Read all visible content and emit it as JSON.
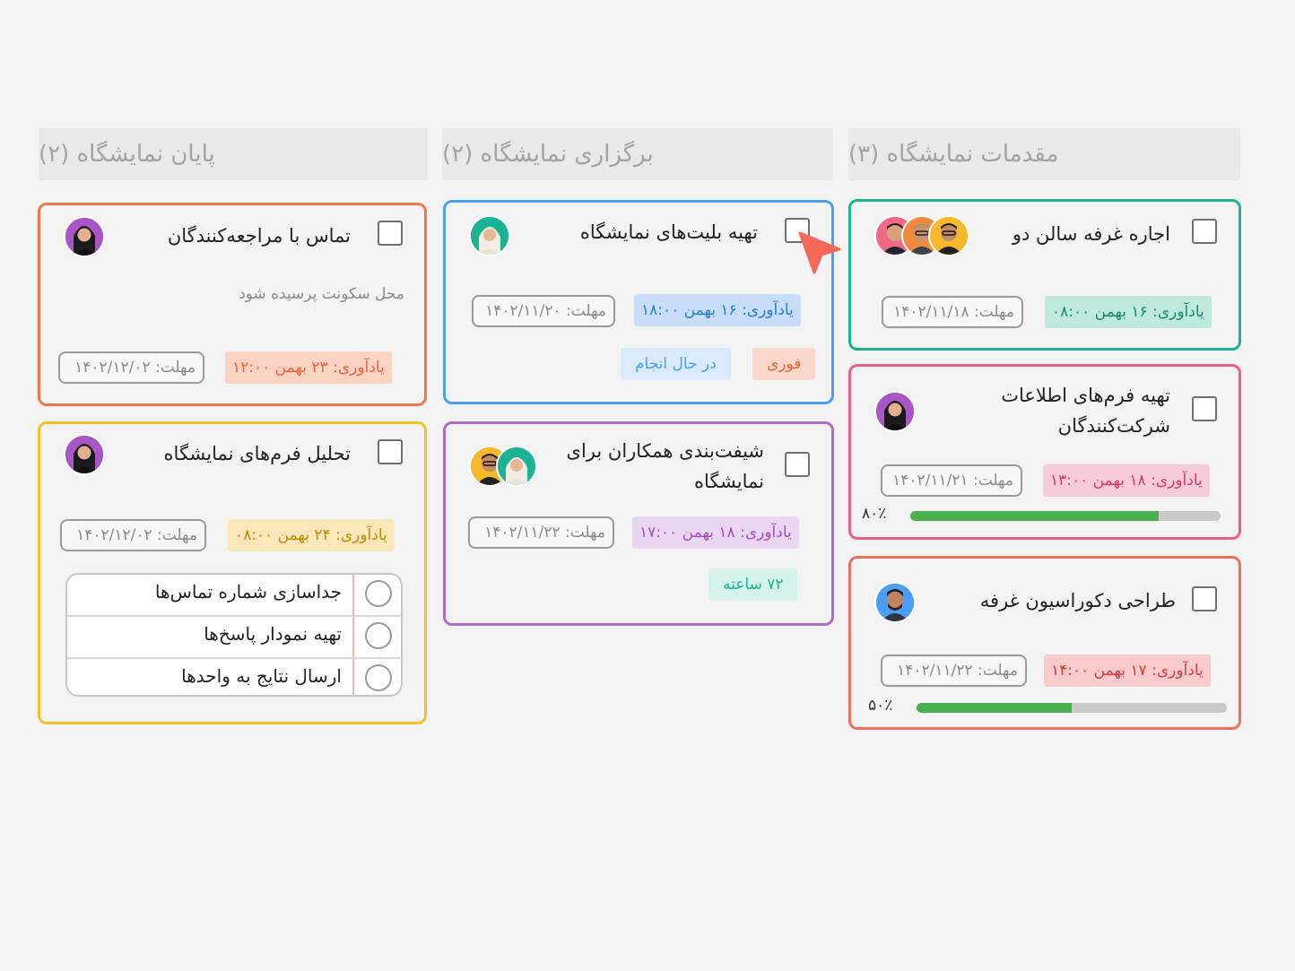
{
  "columns": [
    {
      "id": "prep",
      "title": "مقدمات نمایشگاه (۳)"
    },
    {
      "id": "hold",
      "title": "برگزاری نمایشگاه (۲)"
    },
    {
      "id": "end",
      "title": "پایان نمایشگاه (۲)"
    }
  ],
  "cards": {
    "c1": {
      "title": "اجاره غرفه سالن دو",
      "reminder": "یادآوری: ۱۶ بهمن ۰۸:۰۰",
      "deadline": "مهلت: ۱۴۰۲/۱۱/۱۸",
      "color": "#1ab394"
    },
    "c2": {
      "title_line1": "تهیه فرم‌های اطلاعات",
      "title_line2": "شرکت‌کنندگان",
      "reminder": "یادآوری: ۱۸ بهمن ۱۳:۰۰",
      "deadline": "مهلت: ۱۴۰۲/۱۱/۲۱",
      "progress_label": "۸۰٪",
      "progress": 0.8,
      "color": "#e8608a"
    },
    "c3": {
      "title": "طراحی دکوراسیون غرفه",
      "reminder": "یادآوری: ۱۷ بهمن ۱۴:۰۰",
      "deadline": "مهلت: ۱۴۰۲/۱۱/۲۲",
      "progress_label": "۵۰٪",
      "progress": 0.5,
      "color": "#f07060"
    },
    "c4": {
      "title": "تهیه بلیت‌های نمایشگاه",
      "reminder": "یادآوری: ۱۶ بهمن ۱۸:۰۰",
      "deadline": "مهلت: ۱۴۰۲/۱۱/۲۰",
      "tag_urgent": "فوری",
      "tag_status": "در حال انجام",
      "color": "#4a9ef5"
    },
    "c5": {
      "title_line1": "شیفت‌بندی همکاران برای",
      "title_line2": "نمایشگاه",
      "reminder": "یادآوری: ۱۸ بهمن ۱۷:۰۰",
      "deadline": "مهلت: ۱۴۰۲/۱۱/۲۲",
      "tag_hours": "۷۲ ساعته",
      "color": "#b06ac8"
    },
    "c6": {
      "title": "تماس با مراجعه‌کنندگان",
      "note": "محل سکونت پرسیده شود",
      "reminder": "یادآوری: ۲۳ بهمن ۱۲:۰۰",
      "deadline": "مهلت: ۱۴۰۲/۱۲/۰۲",
      "color": "#f07848"
    },
    "c7": {
      "title": "تحلیل فرم‌های نمایشگاه",
      "reminder": "یادآوری: ۲۴ بهمن ۰۸:۰۰",
      "deadline": "مهلت: ۱۴۰۲/۱۲/۰۲",
      "color": "#f5c02a",
      "checklist": [
        {
          "label": "جداسازی شماره تماس‌ها"
        },
        {
          "label": "تهیه نمودار پاسخ‌ها"
        },
        {
          "label": "ارسال نتایج به واحدها"
        }
      ]
    }
  },
  "icons": {
    "cursor": "pointer-cursor-icon",
    "avatar": "user-avatar"
  }
}
